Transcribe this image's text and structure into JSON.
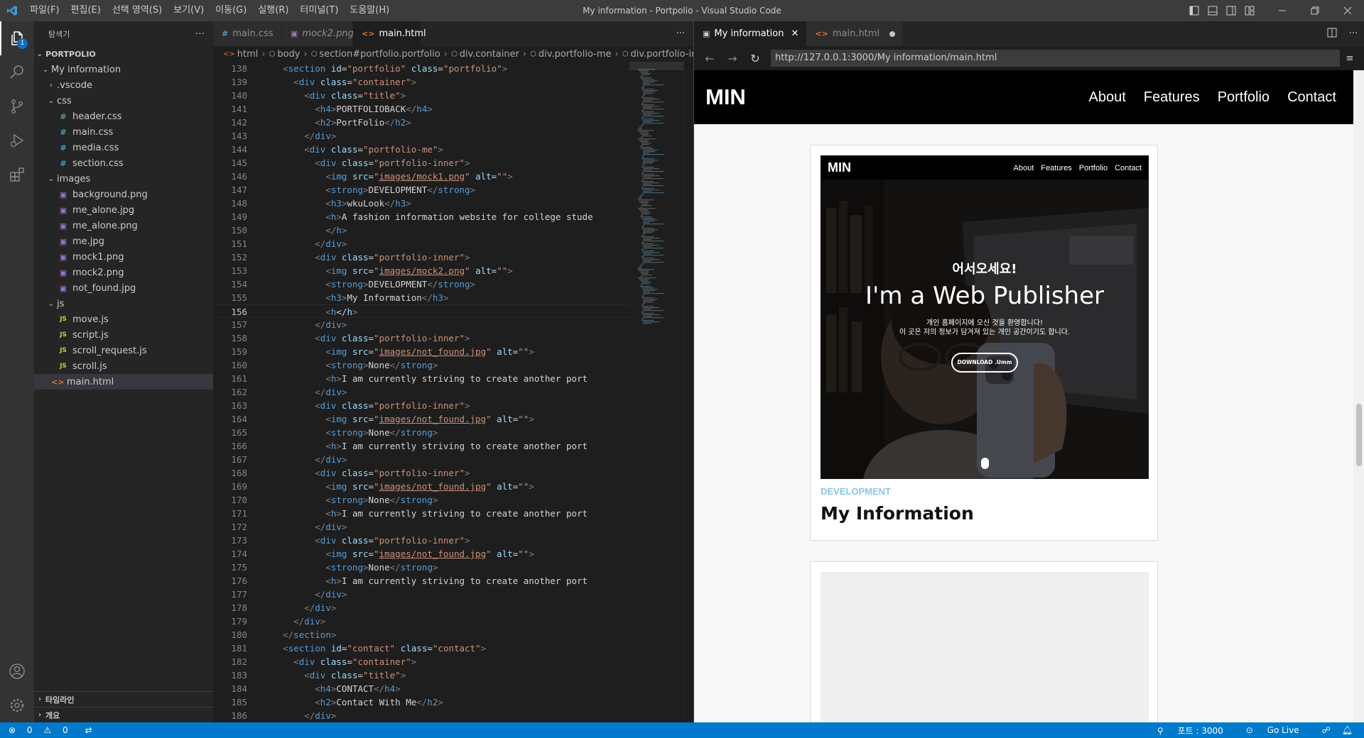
{
  "titlebar": {
    "menu": [
      "파일(F)",
      "편집(E)",
      "선택 영역(S)",
      "보기(V)",
      "이동(G)",
      "실행(R)",
      "터미널(T)",
      "도움말(H)"
    ],
    "title": "My information - Portpolio - Visual Studio Code"
  },
  "activity": {
    "explorer_badge": "1"
  },
  "sidebar": {
    "header": "탐색기",
    "more": "···",
    "root": "PORTPOLIO",
    "bottom_sections": [
      "타임라인",
      "개요"
    ],
    "tree": [
      {
        "label": "My information",
        "kind": "folder-open",
        "depth": 1
      },
      {
        "label": ".vscode",
        "kind": "folder-closed",
        "depth": 2
      },
      {
        "label": "css",
        "kind": "folder-open",
        "depth": 2
      },
      {
        "label": "header.css",
        "kind": "css",
        "depth": 3
      },
      {
        "label": "main.css",
        "kind": "css",
        "depth": 3
      },
      {
        "label": "media.css",
        "kind": "css",
        "depth": 3
      },
      {
        "label": "section.css",
        "kind": "css",
        "depth": 3
      },
      {
        "label": "images",
        "kind": "folder-open",
        "depth": 2
      },
      {
        "label": "background.png",
        "kind": "img",
        "depth": 3
      },
      {
        "label": "me_alone.jpg",
        "kind": "img",
        "depth": 3
      },
      {
        "label": "me_alone.png",
        "kind": "img",
        "depth": 3
      },
      {
        "label": "me.jpg",
        "kind": "img",
        "depth": 3
      },
      {
        "label": "mock1.png",
        "kind": "img",
        "depth": 3
      },
      {
        "label": "mock2.png",
        "kind": "img",
        "depth": 3
      },
      {
        "label": "not_found.jpg",
        "kind": "img",
        "depth": 3
      },
      {
        "label": "js",
        "kind": "folder-open",
        "depth": 2
      },
      {
        "label": "move.js",
        "kind": "js",
        "depth": 3
      },
      {
        "label": "script.js",
        "kind": "js",
        "depth": 3
      },
      {
        "label": "scroll_request.js",
        "kind": "js",
        "depth": 3
      },
      {
        "label": "scroll.js",
        "kind": "js",
        "depth": 3
      },
      {
        "label": "main.html",
        "kind": "html",
        "depth": 2,
        "selected": true
      }
    ]
  },
  "editor": {
    "tabs": [
      {
        "label": "main.css",
        "icon": "#",
        "kind": "css",
        "active": false,
        "italic": false,
        "dirty": false
      },
      {
        "label": "mock2.png",
        "icon": "▣",
        "kind": "img",
        "active": false,
        "italic": true,
        "dirty": false
      },
      {
        "label": "main.html",
        "icon": "<>",
        "kind": "html",
        "active": true,
        "italic": false,
        "dirty": true
      }
    ],
    "more": "···",
    "breadcrumb": [
      "html",
      "body",
      "section#portfolio.portfolio",
      "div.container",
      "div.portfolio-me",
      "div.portfolio-inner"
    ],
    "current_line": 156,
    "lines": [
      {
        "n": 138,
        "i": 4,
        "c": "<section id=\"portfolio\" class=\"portfolio\">"
      },
      {
        "n": 139,
        "i": 6,
        "c": "<div class=\"container\">"
      },
      {
        "n": 140,
        "i": 8,
        "c": "<div class=\"title\">"
      },
      {
        "n": 141,
        "i": 10,
        "c": "<h4>PORTFOLIOBACK</h4>"
      },
      {
        "n": 142,
        "i": 10,
        "c": "<h2>PortFolio</h2>"
      },
      {
        "n": 143,
        "i": 8,
        "c": "</div>"
      },
      {
        "n": 144,
        "i": 8,
        "c": "<div class=\"portfolio-me\">"
      },
      {
        "n": 145,
        "i": 10,
        "c": "<div class=\"portfolio-inner\">"
      },
      {
        "n": 146,
        "i": 12,
        "c": "<img src=\"images/mock1.png\" alt=\"\">"
      },
      {
        "n": 147,
        "i": 12,
        "c": "<strong>DEVELOPMENT</strong>"
      },
      {
        "n": 148,
        "i": 12,
        "c": "<h3>wkuLook</h3>"
      },
      {
        "n": 149,
        "i": 12,
        "c": "<h>A fashion information website for college stude"
      },
      {
        "n": 150,
        "i": 12,
        "c": "</h>"
      },
      {
        "n": 151,
        "i": 10,
        "c": "</div>"
      },
      {
        "n": 152,
        "i": 10,
        "c": "<div class=\"portfolio-inner\">"
      },
      {
        "n": 153,
        "i": 12,
        "c": "<img src=\"images/mock2.png\" alt=\"\">"
      },
      {
        "n": 154,
        "i": 12,
        "c": "<strong>DEVELOPMENT</strong>"
      },
      {
        "n": 155,
        "i": 12,
        "c": "<h3>My Information</h3>"
      },
      {
        "n": 156,
        "i": 12,
        "c": "<h</h>"
      },
      {
        "n": 157,
        "i": 10,
        "c": "</div>"
      },
      {
        "n": 158,
        "i": 10,
        "c": "<div class=\"portfolio-inner\">"
      },
      {
        "n": 159,
        "i": 12,
        "c": "<img src=\"images/not_found.jpg\" alt=\"\">"
      },
      {
        "n": 160,
        "i": 12,
        "c": "<strong>None</strong>"
      },
      {
        "n": 161,
        "i": 12,
        "c": "<h>I am currently striving to create another port"
      },
      {
        "n": 162,
        "i": 10,
        "c": "</div>"
      },
      {
        "n": 163,
        "i": 10,
        "c": "<div class=\"portfolio-inner\">"
      },
      {
        "n": 164,
        "i": 12,
        "c": "<img src=\"images/not_found.jpg\" alt=\"\">"
      },
      {
        "n": 165,
        "i": 12,
        "c": "<strong>None</strong>"
      },
      {
        "n": 166,
        "i": 12,
        "c": "<h>I am currently striving to create another port"
      },
      {
        "n": 167,
        "i": 10,
        "c": "</div>"
      },
      {
        "n": 168,
        "i": 10,
        "c": "<div class=\"portfolio-inner\">"
      },
      {
        "n": 169,
        "i": 12,
        "c": "<img src=\"images/not_found.jpg\" alt=\"\">"
      },
      {
        "n": 170,
        "i": 12,
        "c": "<strong>None</strong>"
      },
      {
        "n": 171,
        "i": 12,
        "c": "<h>I am currently striving to create another port"
      },
      {
        "n": 172,
        "i": 10,
        "c": "</div>"
      },
      {
        "n": 173,
        "i": 10,
        "c": "<div class=\"portfolio-inner\">"
      },
      {
        "n": 174,
        "i": 12,
        "c": "<img src=\"images/not_found.jpg\" alt=\"\">"
      },
      {
        "n": 175,
        "i": 12,
        "c": "<strong>None</strong>"
      },
      {
        "n": 176,
        "i": 12,
        "c": "<h>I am currently striving to create another port"
      },
      {
        "n": 177,
        "i": 10,
        "c": "</div>"
      },
      {
        "n": 178,
        "i": 8,
        "c": "</div>"
      },
      {
        "n": 179,
        "i": 6,
        "c": "</div>"
      },
      {
        "n": 180,
        "i": 4,
        "c": "</section>"
      },
      {
        "n": 181,
        "i": 4,
        "c": "<section id=\"contact\" class=\"contact\">"
      },
      {
        "n": 182,
        "i": 6,
        "c": "<div class=\"container\">"
      },
      {
        "n": 183,
        "i": 8,
        "c": "<div class=\"title\">"
      },
      {
        "n": 184,
        "i": 10,
        "c": "<h4>CONTACT</h4>"
      },
      {
        "n": 185,
        "i": 10,
        "c": "<h2>Contact With Me</h2>"
      },
      {
        "n": 186,
        "i": 8,
        "c": "</div>"
      }
    ]
  },
  "preview": {
    "tabs": [
      {
        "label": "My information",
        "icon": "▣",
        "active": true,
        "close": "✕"
      },
      {
        "label": "main.html",
        "icon": "<>",
        "active": false,
        "dirty": true
      }
    ],
    "url": "http://127.0.0.1:3000/My information/main.html",
    "site": {
      "logo": "MIN",
      "nav": [
        "About",
        "Features",
        "Portfolio",
        "Contact"
      ],
      "card": {
        "mock": {
          "logo": "MIN",
          "nav": [
            "About",
            "Features",
            "Portfolio",
            "Contact"
          ],
          "welcome": "어서오세요!",
          "hero": "I'm a Web Publisher",
          "sub1": "개인 홈페이지에 오신 것을 환영합니다!",
          "sub2": "이 곳은 저의 정보가 담겨져 있는 개인 공간이기도 합니다.",
          "button": "DOWNLOAD .Umm"
        },
        "category": "DEVELOPMENT",
        "title": "My Information"
      }
    }
  },
  "statusbar": {
    "errors": "0",
    "warnings": "0",
    "port": "포트 : 3000",
    "golive": "Go Live"
  },
  "colors": {
    "accent": "#007acc",
    "category": "#87c6e8"
  }
}
